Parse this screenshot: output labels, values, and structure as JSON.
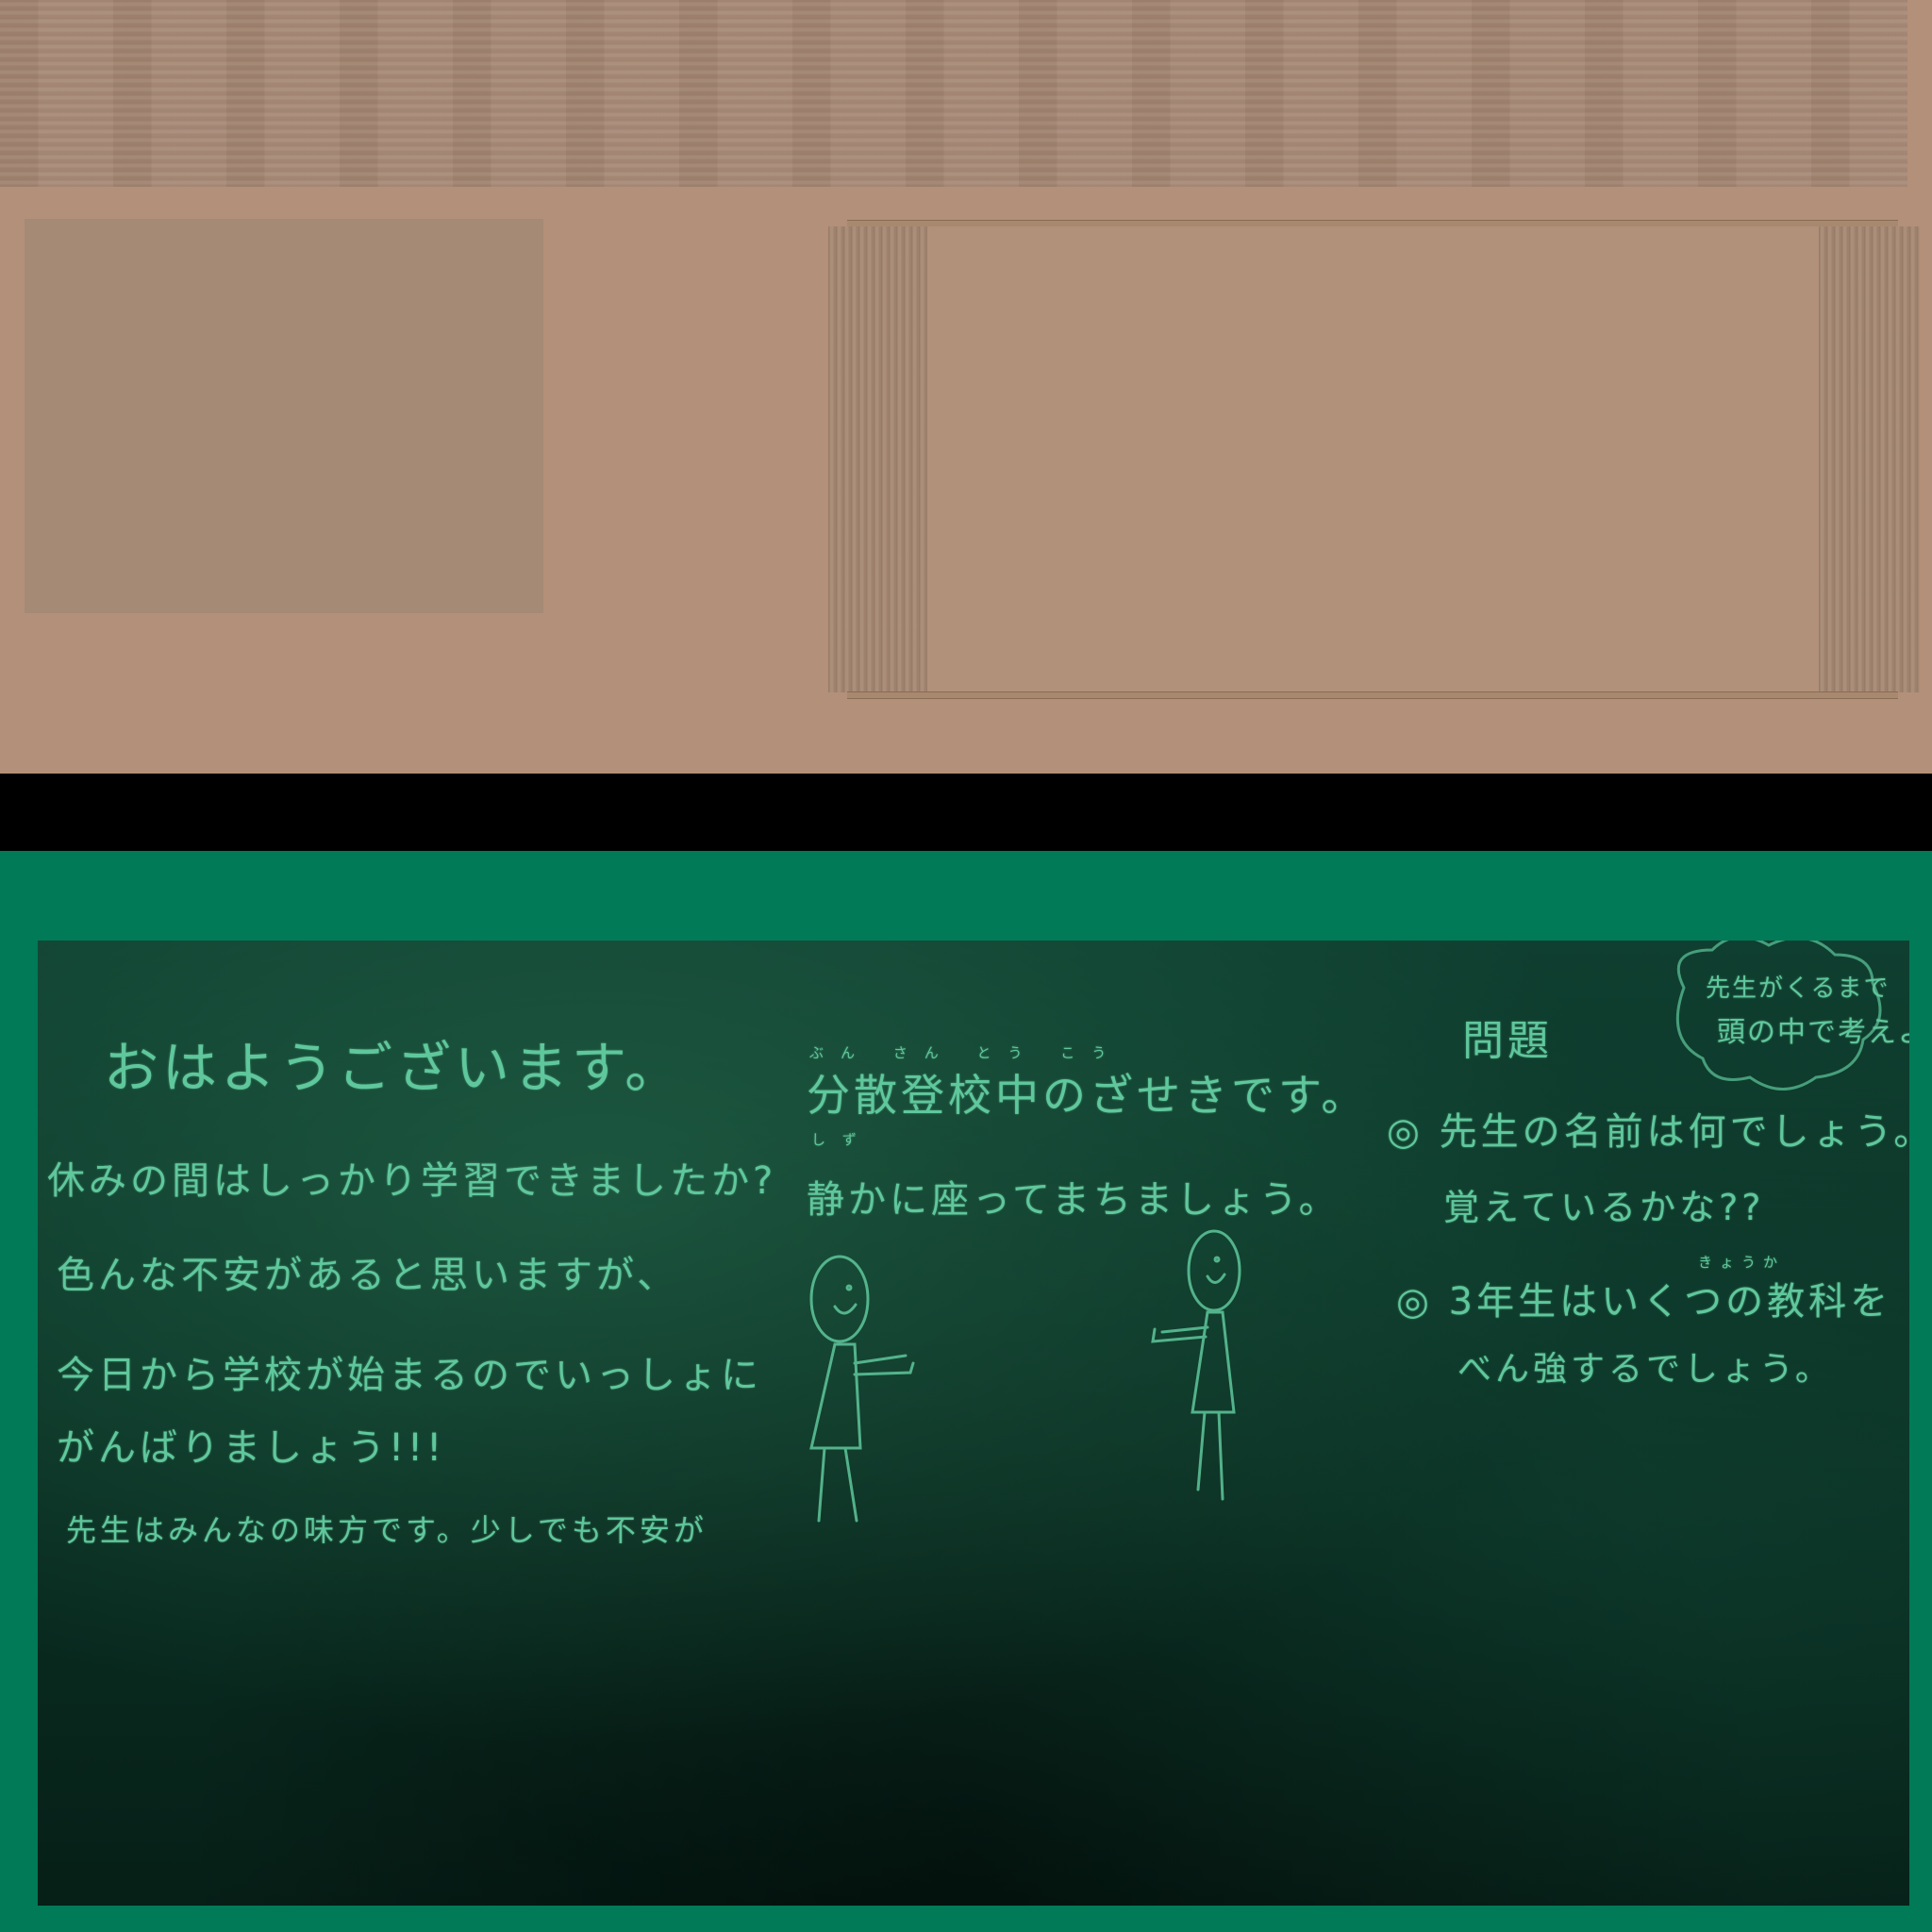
{
  "board": {
    "left_column": [
      "おはようございます。",
      "休みの間はしっかり学習できましたか?",
      "色んな不安があると思いますが、",
      "今日から学校が始まるのでいっしょに",
      "がんばりましょう!!!",
      "先生はみんなの味方です。少しでも不安が"
    ],
    "middle": {
      "ruby_line": "ぶん さん とう こう",
      "title": "分散登校中のざせきです。",
      "ruby_shizu": "しず",
      "instruction": "静かに座ってまちましょう。"
    },
    "right": {
      "heading": "問題",
      "bubble_line1": "先生がくるまで",
      "bubble_line2": "頭の中で考えよう",
      "q1_line1": "◎ 先生の名前は何でしょう。",
      "q1_line2": "覚えているかな??",
      "ruby_kyouka": "きょうか",
      "q2_line1": "◎ 3年生はいくつの教科を",
      "q2_line2": "べん強するでしょう。"
    }
  },
  "colors": {
    "chalk": "#5fc79c",
    "board": "#0b3326",
    "band": "#007a57",
    "wall": "#b39079"
  }
}
